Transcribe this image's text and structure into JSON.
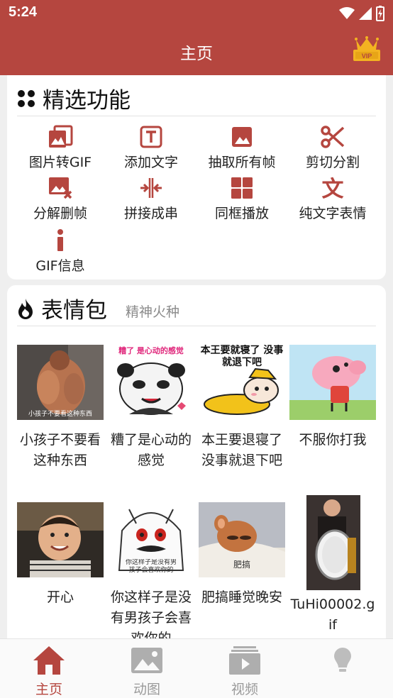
{
  "status_bar": {
    "time": "5:24"
  },
  "app_bar": {
    "title": "主页",
    "vip_label": "VIP"
  },
  "featured": {
    "title": "精选功能",
    "items": [
      {
        "label": "图片转GIF",
        "icon": "images-icon"
      },
      {
        "label": "添加文字",
        "icon": "add-text-icon"
      },
      {
        "label": "抽取所有帧",
        "icon": "image-frame-icon"
      },
      {
        "label": "剪切分割",
        "icon": "scissors-icon"
      },
      {
        "label": "分解删帧",
        "icon": "image-delete-icon"
      },
      {
        "label": "拼接成串",
        "icon": "merge-icon"
      },
      {
        "label": "同框播放",
        "icon": "grid-icon"
      },
      {
        "label": "纯文字表情",
        "icon": "text-icon"
      },
      {
        "label": "GIF信息",
        "icon": "info-icon"
      }
    ]
  },
  "stickers": {
    "title": "表情包",
    "subtitle": "精神火种",
    "items": [
      {
        "caption": "小孩子不要看这种东西",
        "thumb_text": "小孩子不要看这种东西"
      },
      {
        "caption": "糟了是心动的感觉",
        "thumb_text": "糟了 是心动的感觉"
      },
      {
        "caption": "本王要退寝了没事就退下吧",
        "thumb_text": "本王要就寝了 没事就退下吧"
      },
      {
        "caption": "不服你打我",
        "thumb_text": ""
      },
      {
        "caption": "开心",
        "thumb_text": ""
      },
      {
        "caption": "你这样子是没有男孩子会喜欢你的",
        "thumb_text": "你这样子是没有男孩子会喜欢你的"
      },
      {
        "caption": "肥搞睡觉晚安",
        "thumb_text": "肥搞"
      },
      {
        "caption": "TuHi00002.gif",
        "thumb_text": ""
      }
    ]
  },
  "bottom_nav": {
    "items": [
      {
        "label": "主页",
        "active": true
      },
      {
        "label": "动图",
        "active": false
      },
      {
        "label": "视频",
        "active": false
      },
      {
        "label": "",
        "active": false
      }
    ]
  },
  "colors": {
    "primary": "#b5463f",
    "icon": "#b5463f"
  }
}
